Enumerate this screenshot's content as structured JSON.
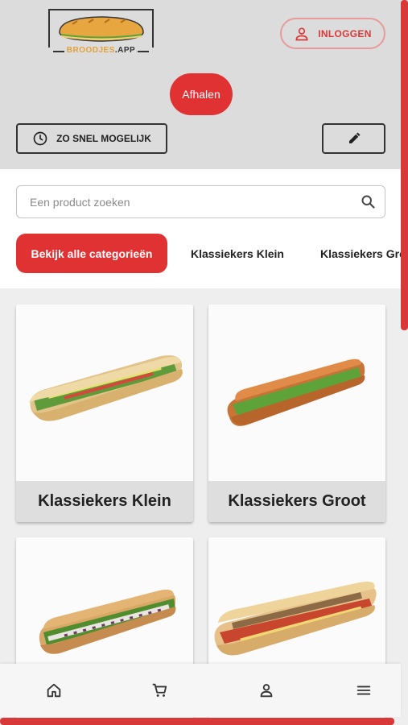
{
  "header": {
    "logo": {
      "brand_left": "BROODJES",
      "brand_right": ".APP"
    },
    "login_label": "INLOGGEN",
    "pickup_label": "Afhalen",
    "time_label": "ZO SNEL MOGELIJK"
  },
  "search": {
    "placeholder": "Een product zoeken",
    "value": ""
  },
  "categories": {
    "all_label": "Bekijk alle categorieën",
    "tabs": [
      "Klassiekers Klein",
      "Klassiekers Groot"
    ]
  },
  "products": [
    {
      "label": "Klassiekers Klein"
    },
    {
      "label": "Klassiekers Groot"
    },
    {
      "label": ""
    },
    {
      "label": ""
    }
  ],
  "bottom_nav": {
    "icons": [
      "home-icon",
      "cart-icon",
      "user-icon",
      "menu-icon"
    ]
  },
  "colors": {
    "accent": "#e03232",
    "header_bg": "#dcdcdc",
    "logo_orange": "#e4a23a"
  }
}
